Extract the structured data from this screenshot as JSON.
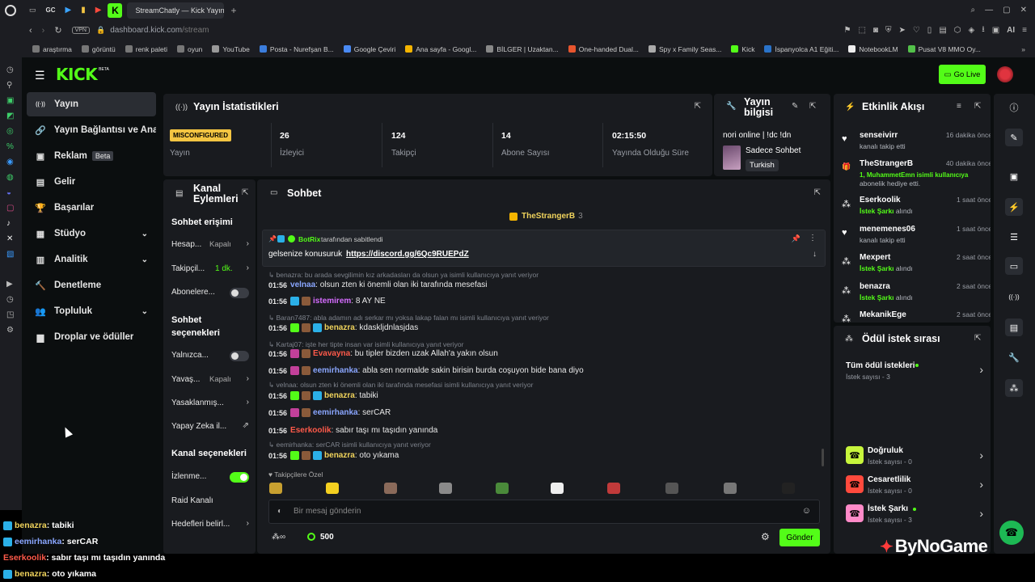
{
  "browser": {
    "tab_title": "StreamChatly — Kick Yayını",
    "tab_short": "GC",
    "vpn": "VPN",
    "url_domain": "dashboard.kick.com",
    "url_path": "/stream",
    "ai_label": "AI",
    "bookmarks": [
      {
        "label": "araştırma",
        "color": "#777"
      },
      {
        "label": "görüntü",
        "color": "#777"
      },
      {
        "label": "renk paleti",
        "color": "#777"
      },
      {
        "label": "oyun",
        "color": "#777"
      },
      {
        "label": "YouTube",
        "color": "#999"
      },
      {
        "label": "Posta - Nurefşan B...",
        "color": "#3b7ddd"
      },
      {
        "label": "Google Çeviri",
        "color": "#4a8af4"
      },
      {
        "label": "Ana sayfa - Googl...",
        "color": "#f4b400"
      },
      {
        "label": "BİLGER | Uzaktan...",
        "color": "#888"
      },
      {
        "label": "One-handed Dual...",
        "color": "#e8552e"
      },
      {
        "label": "Spy x Family Seas...",
        "color": "#aaa"
      },
      {
        "label": "Kick",
        "color": "#53fc18"
      },
      {
        "label": "İspanyolca A1 Eğiti...",
        "color": "#2a73c9"
      },
      {
        "label": "NotebookLM",
        "color": "#eee"
      },
      {
        "label": "Pusat V8 MMO Oy...",
        "color": "#53c14a"
      }
    ]
  },
  "header": {
    "logo": "KICK",
    "logo_sup": "BETA",
    "go_live": "Go Live"
  },
  "nav": {
    "items": [
      {
        "label": "Yayın",
        "icon": "broadcast-icon",
        "glyph": "((·))",
        "active": true
      },
      {
        "label": "Yayın Bağlantısı ve Anahtarı",
        "icon": "link-icon",
        "glyph": "🔗"
      },
      {
        "label": "Reklam",
        "icon": "ad-icon",
        "glyph": "▣",
        "badge": "Beta"
      },
      {
        "label": "Gelir",
        "icon": "revenue-icon",
        "glyph": "▤"
      },
      {
        "label": "Başarılar",
        "icon": "trophy-icon",
        "glyph": "🏆"
      },
      {
        "label": "Stüdyo",
        "icon": "studio-icon",
        "glyph": "▦",
        "chevron": true
      },
      {
        "label": "Analitik",
        "icon": "analytics-icon",
        "glyph": "▥",
        "chevron": true
      },
      {
        "label": "Denetleme",
        "icon": "hammer-icon",
        "glyph": "🔨"
      },
      {
        "label": "Topluluk",
        "icon": "community-icon",
        "glyph": "👥",
        "chevron": true
      },
      {
        "label": "Droplar ve ödüller",
        "icon": "drops-icon",
        "glyph": "▆"
      }
    ]
  },
  "stats": {
    "title": "Yayın İstatistikleri",
    "status_badge": "MISCONFIGURED",
    "status_label": "Yayın",
    "viewers": "26",
    "viewers_label": "İzleyici",
    "followers": "124",
    "followers_label": "Takipçi",
    "subs": "14",
    "subs_label": "Abone Sayısı",
    "uptime": "02:15:50",
    "uptime_label": "Yayında Olduğu Süre"
  },
  "info": {
    "title": "Yayın bilgisi",
    "stream_title": "nori online | !dc !dn",
    "category": "Sadece Sohbet",
    "language": "Turkish"
  },
  "actions": {
    "title": "Kanal Eylemleri",
    "chat_access": "Sohbet erişimi",
    "account_row": "Hesap...",
    "account_val": "Kapalı",
    "follower_row": "Takipçil...",
    "follower_val": "1 dk.",
    "subs_row": "Abonelere...",
    "chat_options": "Sohbet seçenekleri",
    "only_row": "Yalnızca...",
    "slow_row": "Yavaş...",
    "slow_val": "Kapalı",
    "banned_row": "Yasaklanmış...",
    "ai_row": "Yapay Zeka il...",
    "channel_options": "Kanal seçenekleri",
    "watch_row": "İzlenme...",
    "raid_row": "Raid Kanalı",
    "goals_row": "Hedefleri belirl..."
  },
  "chat": {
    "title": "Sohbet",
    "top_gifter": "TheStrangerB",
    "top_gifter_count": "3",
    "pinned_by": "BotRix",
    "pinned_suffix": "tarafından sabitlendi",
    "pinned_text": "gelsenize konusuruk",
    "pinned_link": "https://discord.gg/6Qc9RUEPdZ",
    "messages": [
      {
        "reply": "benazra: bu arada sevgilimin kız arkadasları da olsun ya isimli kullanıcıya yanıt veriyor"
      },
      {
        "time": "01:56",
        "user": "velnaa",
        "color": "#8aa6ff",
        "text": ": olsun zten ki önemli olan iki tarafında mesefasi"
      },
      {
        "time": "01:56",
        "user": "istemirem",
        "color": "#d66cff",
        "text": ": 8 AY NE",
        "badge": "#2bb0e8"
      },
      {
        "reply": "Baran7487: abla adamın adı serkar mı yoksa lakap falan mı isimli kullanıcıya yanıt veriyor"
      },
      {
        "time": "01:56",
        "user": "benazra",
        "color": "#f0d35c",
        "text": ": kdaskljdnlasjdas",
        "badge": "#53fc18"
      },
      {
        "reply": "Kartaj07: işte her tipte insan var isimli kullanıcıya yanıt veriyor"
      },
      {
        "time": "01:56",
        "user": "Evavayna",
        "color": "#ff5a4a",
        "text": ": bu tipler bizden uzak Allah'a yakın olsun",
        "badge": "#c2409a"
      },
      {
        "time": "01:56",
        "user": "eemirhanka",
        "color": "#8aa6ff",
        "text": ": abla sen normalde sakin birisin burda coşuyon bide bana diyo",
        "badge": "#c2409a"
      },
      {
        "reply": "velnaa: olsun zten ki önemli olan iki tarafında mesefasi isimli kullanıcıya yanıt veriyor"
      },
      {
        "time": "01:56",
        "user": "benazra",
        "color": "#f0d35c",
        "text": ": tabiki",
        "badge": "#53fc18"
      },
      {
        "time": "01:56",
        "user": "eemirhanka",
        "color": "#8aa6ff",
        "text": ": serCAR",
        "badge": "#c2409a"
      },
      {
        "time": "01:56",
        "user": "Eserkoolik",
        "color": "#ff5a4a",
        "text": ": sabır taşı mı taşıdın yanında"
      },
      {
        "reply": "eemirhanka: serCAR isimli kullanıcıya yanıt veriyor"
      },
      {
        "time": "01:56",
        "user": "benazra",
        "color": "#f0d35c",
        "text": ": oto yıkama",
        "badge": "#53fc18"
      }
    ],
    "emote_header": "Takipçilere Özel",
    "input_placeholder": "Bir mesaj gönderin",
    "points": "500",
    "send": "Gönder"
  },
  "events": {
    "title": "Etkinlik Akışı",
    "items": [
      {
        "name": "senseivirr",
        "desc": "kanalı takip etti",
        "time": "16 dakika önce",
        "icon": "heart-icon",
        "glyph": "♥"
      },
      {
        "name": "TheStrangerB",
        "desc": "1, MuhammetEmn isimli kullanıcıya",
        "desc2": "abonelik hediye etti.",
        "time": "40 dakika önce",
        "icon": "gift-icon",
        "glyph": "🎁"
      },
      {
        "name": "Eserkoolik",
        "desc": "İstek Şarkı",
        "desc_suffix": " alındı",
        "time": "1 saat önce",
        "icon": "reward-icon",
        "glyph": "⁂"
      },
      {
        "name": "menemenes06",
        "desc": "kanalı takip etti",
        "time": "1 saat önce",
        "icon": "heart-icon",
        "glyph": "♥"
      },
      {
        "name": "Mexpert",
        "desc": "İstek Şarkı",
        "desc_suffix": " alındı",
        "time": "2 saat önce",
        "icon": "reward-icon",
        "glyph": "⁂"
      },
      {
        "name": "benazra",
        "desc": "İstek Şarkı",
        "desc_suffix": " alındı",
        "time": "2 saat önce",
        "icon": "reward-icon",
        "glyph": "⁂"
      },
      {
        "name": "MekanikEge",
        "desc": "",
        "time": "2 saat önce",
        "icon": "reward-icon",
        "glyph": "⁂"
      }
    ]
  },
  "rewards": {
    "title": "Ödül istek sırası",
    "all_label": "Tüm ödül istekleri",
    "all_count": "İstek sayısı - 3",
    "items": [
      {
        "label": "Doğruluk",
        "count": "İstek sayısı - 0",
        "color": "#c7f53c"
      },
      {
        "label": "Cesaretlilik",
        "count": "İstek sayısı - 0",
        "color": "#ff4a3d"
      },
      {
        "label": "İstek Şarkı",
        "count": "İstek sayısı - 3",
        "color": "#ff8ac8"
      }
    ]
  },
  "overlay": {
    "lines": [
      {
        "user": "benazra",
        "color": "#f0d35c",
        "text": " : tabiki"
      },
      {
        "user": "eemirhanka",
        "color": "#8aa6ff",
        "text": " : serCAR"
      },
      {
        "user": "Eserkoolik",
        "color": "#ff5a4a",
        "text": " : sabır taşı mı taşıdın yanında"
      },
      {
        "user": "benazra",
        "color": "#f0d35c",
        "text": " : oto yıkama"
      }
    ],
    "watermark": "ByNoGame"
  }
}
